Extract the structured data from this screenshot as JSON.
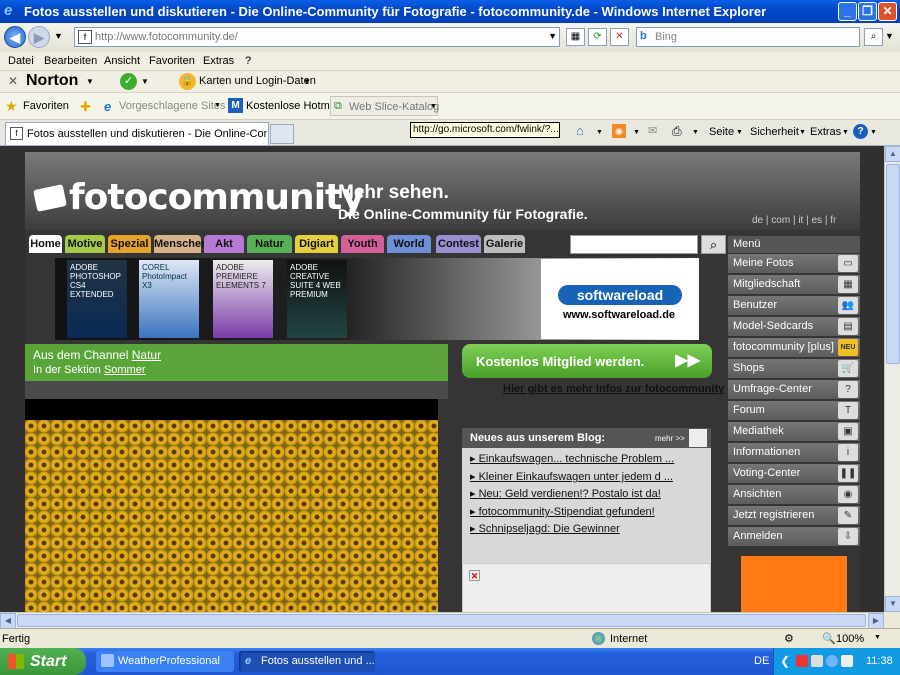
{
  "window": {
    "title": "Fotos ausstellen und diskutieren - Die Online-Community für Fotografie - fotocommunity.de - Windows Internet Explorer"
  },
  "address": {
    "url": "http://www.fotocommunity.de/",
    "search_placeholder": "Bing"
  },
  "menubar": [
    "Datei",
    "Bearbeiten",
    "Ansicht",
    "Favoriten",
    "Extras",
    "?"
  ],
  "norton": {
    "brand": "Norton",
    "identity": "Karten und Login-Daten"
  },
  "favorites": {
    "label": "Favoriten",
    "items": [
      "Vorgeschlagene Sites",
      "Kostenlose Hotmail",
      "Web Slice-Katalog"
    ]
  },
  "tab": {
    "title": "Fotos ausstellen und diskutieren - Die Online-Communi...",
    "tooltip": "http://go.microsoft.com/fwlink/?..."
  },
  "commandbar": [
    "Seite",
    "Sicherheit",
    "Extras"
  ],
  "site": {
    "logo": "fotocommunity",
    "tagline_1": "Mehr sehen.",
    "tagline_2": "Die Online-Community für Fotografie.",
    "languages": "de | com | it | es | fr",
    "nav_tabs": [
      {
        "label": "Home",
        "color": "#ffffff"
      },
      {
        "label": "Motive",
        "color": "#a7c94a"
      },
      {
        "label": "Spezial",
        "color": "#e6a22e"
      },
      {
        "label": "Menschen",
        "color": "#d7b38a"
      },
      {
        "label": "Akt",
        "color": "#b57ad6"
      },
      {
        "label": "Natur",
        "color": "#58b054"
      },
      {
        "label": "Digiart",
        "color": "#e5ce3f"
      },
      {
        "label": "Youth",
        "color": "#d4609a"
      },
      {
        "label": "World",
        "color": "#6f8fd6"
      },
      {
        "label": "Contest",
        "color": "#9a8fd0"
      },
      {
        "label": "Galerie",
        "color": "#bdbdbd"
      }
    ],
    "banner": {
      "products": [
        "ADOBE PHOTOSHOP CS4 EXTENDED",
        "COREL PhotoImpact X3",
        "ADOBE PREMIERE ELEMENTS 7",
        "ADOBE CREATIVE SUITE 4 WEB PREMIUM"
      ],
      "sponsor": "softwareload",
      "sponsor_url": "www.softwareload.de"
    },
    "channel": {
      "prefix": "Aus dem Channel",
      "channel": "Natur",
      "section_prefix": "In der Sektion",
      "section": "Sommer"
    },
    "cta": {
      "button": "Kostenlos Mitglied werden.",
      "link": "Hier gibt es mehr Infos zur fotocommunity"
    },
    "blog": {
      "title": "Neues aus unserem Blog:",
      "more": "mehr >>",
      "items": [
        "Einkaufswagen... technische Problem ...",
        "Kleiner Einkaufswagen unter jedem d ...",
        "Neu: Geld verdienen!? Postalo ist da!",
        "fotocommunity-Stipendiat gefunden!",
        "Schnipseljagd: Die Gewinner"
      ]
    },
    "menu": {
      "title": "Menü",
      "items": [
        {
          "label": "Meine Fotos",
          "icon": "photos-icon"
        },
        {
          "label": "Mitgliedschaft",
          "icon": "membership-icon"
        },
        {
          "label": "Benutzer",
          "icon": "users-icon"
        },
        {
          "label": "Model-Sedcards",
          "icon": "sedcard-icon"
        },
        {
          "label": "fotocommunity [plus]",
          "icon": "plus-icon",
          "badge": "NEU"
        },
        {
          "label": "Shops",
          "icon": "cart-icon"
        },
        {
          "label": "Umfrage-Center",
          "icon": "question-icon"
        },
        {
          "label": "Forum",
          "icon": "forum-icon"
        },
        {
          "label": "Mediathek",
          "icon": "media-icon"
        },
        {
          "label": "Informationen",
          "icon": "info-icon"
        },
        {
          "label": "Voting-Center",
          "icon": "pause-icon"
        },
        {
          "label": "Ansichten",
          "icon": "eye-icon"
        },
        {
          "label": "Jetzt registrieren",
          "icon": "pen-icon"
        },
        {
          "label": "Anmelden",
          "icon": "login-icon"
        }
      ]
    }
  },
  "status": {
    "text": "Fertig",
    "zone": "Internet",
    "zoom": "100%"
  },
  "taskbar": {
    "start": "Start",
    "buttons": [
      "WeatherProfessional",
      "Fotos ausstellen und ..."
    ],
    "lang": "DE",
    "clock": "11:38"
  }
}
